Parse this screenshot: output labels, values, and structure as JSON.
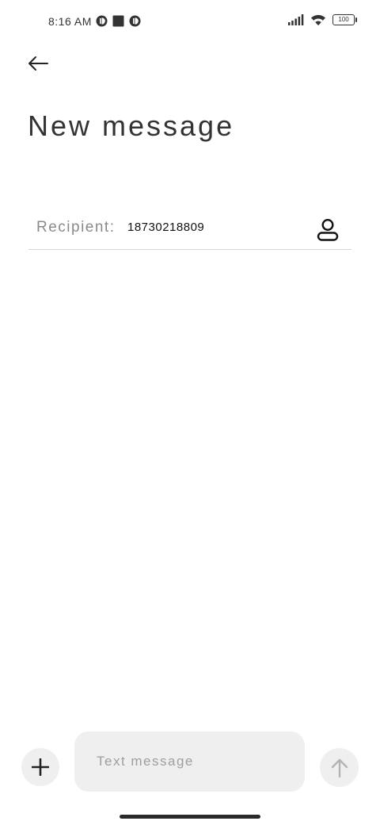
{
  "status_bar": {
    "time": "8:16 AM",
    "battery": "100",
    "left_icons": [
      "notification-app-icon",
      "square-app-icon",
      "notification-app-icon"
    ],
    "right_icons": [
      "signal-icon",
      "wifi-icon",
      "battery-icon"
    ]
  },
  "header": {
    "back_icon": "arrow-left-icon",
    "title": "New message"
  },
  "recipient": {
    "label": "Recipient:",
    "value": "18730218809",
    "contact_icon": "person-icon"
  },
  "composer": {
    "add_icon": "plus-icon",
    "placeholder": "Text message",
    "send_icon": "arrow-up-icon"
  }
}
